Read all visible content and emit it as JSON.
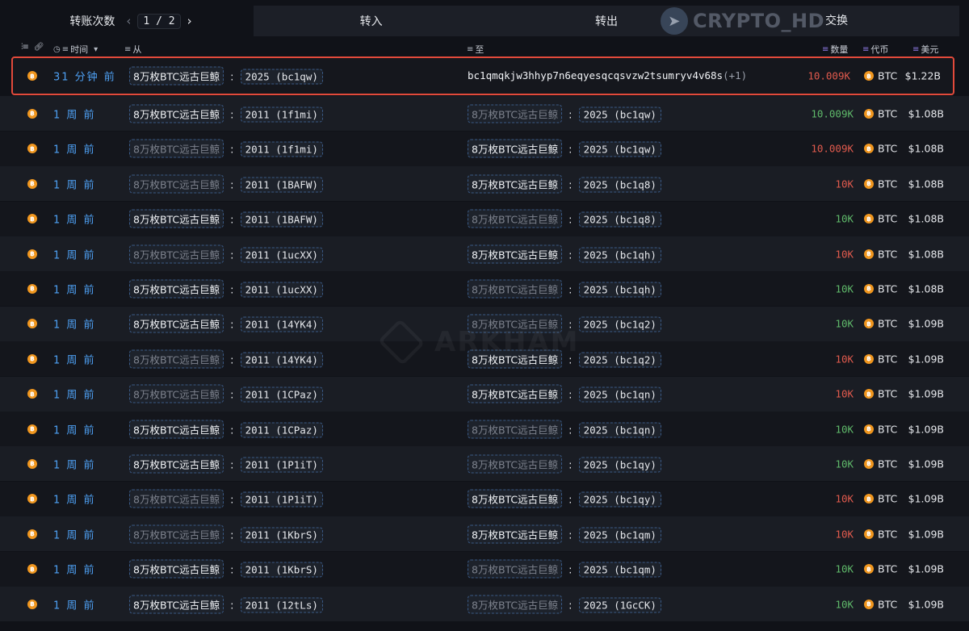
{
  "topbar": {
    "count_label": "转账次数",
    "page_current": "1",
    "page_sep": "/",
    "page_total": "2",
    "tab_in": "转入",
    "tab_out": "转出",
    "tab_exchange": "交换",
    "watermark_text": "CRYPTO_HD"
  },
  "columns": {
    "time": "时间",
    "from": "从",
    "to": "至",
    "amount": "数量",
    "token": "代币",
    "usd": "美元"
  },
  "colors": {
    "highlight_border": "#e24a3b",
    "time_blue": "#4ea1f5",
    "amount_red": "#e05a4d",
    "amount_green": "#5fb96a",
    "btc_orange": "#f0961e"
  },
  "background_watermark": "ARKHAM",
  "rows": [
    {
      "time": "31 分钟 前",
      "from_entity": "8万枚BTC远古巨鲸",
      "from_addr": "2025 (bc1qw)",
      "to_entity": "",
      "to_addr": "bc1qmqkjw3hhyp7n6eqyesqcqsvzw2tsumryv4v68s",
      "to_extra": "(+1)",
      "amount": "10.009K",
      "amount_color": "red",
      "token": "BTC",
      "usd": "$1.22B",
      "from_dim": false,
      "to_dim": false
    },
    {
      "time": "1 周 前",
      "from_entity": "8万枚BTC远古巨鲸",
      "from_addr": "2011 (1f1mi)",
      "to_entity": "8万枚BTC远古巨鲸",
      "to_addr": "2025 (bc1qw)",
      "to_extra": "",
      "amount": "10.009K",
      "amount_color": "green",
      "token": "BTC",
      "usd": "$1.08B",
      "from_dim": false,
      "to_dim": true
    },
    {
      "time": "1 周 前",
      "from_entity": "8万枚BTC远古巨鲸",
      "from_addr": "2011 (1f1mi)",
      "to_entity": "8万枚BTC远古巨鲸",
      "to_addr": "2025 (bc1qw)",
      "to_extra": "",
      "amount": "10.009K",
      "amount_color": "red",
      "token": "BTC",
      "usd": "$1.08B",
      "from_dim": true,
      "to_dim": false
    },
    {
      "time": "1 周 前",
      "from_entity": "8万枚BTC远古巨鲸",
      "from_addr": "2011 (1BAFW)",
      "to_entity": "8万枚BTC远古巨鲸",
      "to_addr": "2025 (bc1q8)",
      "to_extra": "",
      "amount": "10K",
      "amount_color": "red",
      "token": "BTC",
      "usd": "$1.08B",
      "from_dim": true,
      "to_dim": false
    },
    {
      "time": "1 周 前",
      "from_entity": "8万枚BTC远古巨鲸",
      "from_addr": "2011 (1BAFW)",
      "to_entity": "8万枚BTC远古巨鲸",
      "to_addr": "2025 (bc1q8)",
      "to_extra": "",
      "amount": "10K",
      "amount_color": "green",
      "token": "BTC",
      "usd": "$1.08B",
      "from_dim": false,
      "to_dim": true
    },
    {
      "time": "1 周 前",
      "from_entity": "8万枚BTC远古巨鲸",
      "from_addr": "2011 (1ucXX)",
      "to_entity": "8万枚BTC远古巨鲸",
      "to_addr": "2025 (bc1qh)",
      "to_extra": "",
      "amount": "10K",
      "amount_color": "red",
      "token": "BTC",
      "usd": "$1.08B",
      "from_dim": true,
      "to_dim": false
    },
    {
      "time": "1 周 前",
      "from_entity": "8万枚BTC远古巨鲸",
      "from_addr": "2011 (1ucXX)",
      "to_entity": "8万枚BTC远古巨鲸",
      "to_addr": "2025 (bc1qh)",
      "to_extra": "",
      "amount": "10K",
      "amount_color": "green",
      "token": "BTC",
      "usd": "$1.08B",
      "from_dim": false,
      "to_dim": true
    },
    {
      "time": "1 周 前",
      "from_entity": "8万枚BTC远古巨鲸",
      "from_addr": "2011 (14YK4)",
      "to_entity": "8万枚BTC远古巨鲸",
      "to_addr": "2025 (bc1q2)",
      "to_extra": "",
      "amount": "10K",
      "amount_color": "green",
      "token": "BTC",
      "usd": "$1.09B",
      "from_dim": false,
      "to_dim": true
    },
    {
      "time": "1 周 前",
      "from_entity": "8万枚BTC远古巨鲸",
      "from_addr": "2011 (14YK4)",
      "to_entity": "8万枚BTC远古巨鲸",
      "to_addr": "2025 (bc1q2)",
      "to_extra": "",
      "amount": "10K",
      "amount_color": "red",
      "token": "BTC",
      "usd": "$1.09B",
      "from_dim": true,
      "to_dim": false
    },
    {
      "time": "1 周 前",
      "from_entity": "8万枚BTC远古巨鲸",
      "from_addr": "2011 (1CPaz)",
      "to_entity": "8万枚BTC远古巨鲸",
      "to_addr": "2025 (bc1qn)",
      "to_extra": "",
      "amount": "10K",
      "amount_color": "red",
      "token": "BTC",
      "usd": "$1.09B",
      "from_dim": true,
      "to_dim": false
    },
    {
      "time": "1 周 前",
      "from_entity": "8万枚BTC远古巨鲸",
      "from_addr": "2011 (1CPaz)",
      "to_entity": "8万枚BTC远古巨鲸",
      "to_addr": "2025 (bc1qn)",
      "to_extra": "",
      "amount": "10K",
      "amount_color": "green",
      "token": "BTC",
      "usd": "$1.09B",
      "from_dim": false,
      "to_dim": true
    },
    {
      "time": "1 周 前",
      "from_entity": "8万枚BTC远古巨鲸",
      "from_addr": "2011 (1P1iT)",
      "to_entity": "8万枚BTC远古巨鲸",
      "to_addr": "2025 (bc1qy)",
      "to_extra": "",
      "amount": "10K",
      "amount_color": "green",
      "token": "BTC",
      "usd": "$1.09B",
      "from_dim": false,
      "to_dim": true
    },
    {
      "time": "1 周 前",
      "from_entity": "8万枚BTC远古巨鲸",
      "from_addr": "2011 (1P1iT)",
      "to_entity": "8万枚BTC远古巨鲸",
      "to_addr": "2025 (bc1qy)",
      "to_extra": "",
      "amount": "10K",
      "amount_color": "red",
      "token": "BTC",
      "usd": "$1.09B",
      "from_dim": true,
      "to_dim": false
    },
    {
      "time": "1 周 前",
      "from_entity": "8万枚BTC远古巨鲸",
      "from_addr": "2011 (1KbrS)",
      "to_entity": "8万枚BTC远古巨鲸",
      "to_addr": "2025 (bc1qm)",
      "to_extra": "",
      "amount": "10K",
      "amount_color": "red",
      "token": "BTC",
      "usd": "$1.09B",
      "from_dim": true,
      "to_dim": false
    },
    {
      "time": "1 周 前",
      "from_entity": "8万枚BTC远古巨鲸",
      "from_addr": "2011 (1KbrS)",
      "to_entity": "8万枚BTC远古巨鲸",
      "to_addr": "2025 (bc1qm)",
      "to_extra": "",
      "amount": "10K",
      "amount_color": "green",
      "token": "BTC",
      "usd": "$1.09B",
      "from_dim": false,
      "to_dim": true
    },
    {
      "time": "1 周 前",
      "from_entity": "8万枚BTC远古巨鲸",
      "from_addr": "2011 (12tLs)",
      "to_entity": "8万枚BTC远古巨鲸",
      "to_addr": "2025 (1GcCK)",
      "to_extra": "",
      "amount": "10K",
      "amount_color": "green",
      "token": "BTC",
      "usd": "$1.09B",
      "from_dim": false,
      "to_dim": true
    }
  ]
}
